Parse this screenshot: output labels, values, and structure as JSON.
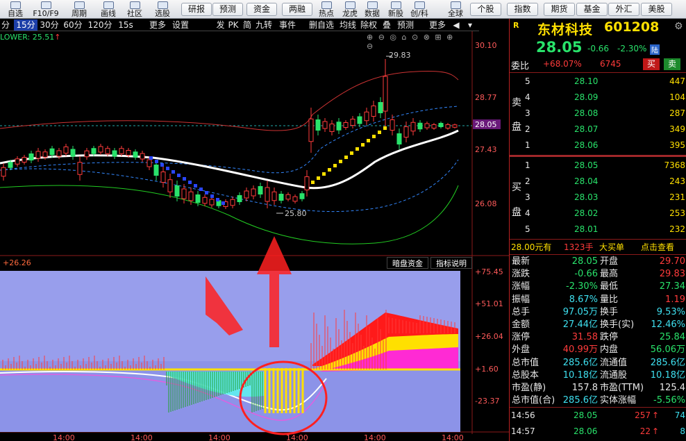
{
  "toolbar": {
    "left_items": [
      "自选",
      "F10/F9",
      "周期",
      "画线",
      "社区",
      "选股"
    ],
    "buttons_mid": [
      "研报",
      "预测",
      "资金",
      "两融"
    ],
    "right_items": [
      "热点",
      "龙虎",
      "数据",
      "新股",
      "创/科",
      "全球"
    ],
    "buttons_right": [
      "个股",
      "指数",
      "期货",
      "基金",
      "外汇",
      "美股"
    ]
  },
  "subbar": {
    "items": [
      "分",
      "15分",
      "30分",
      "60分",
      "120分",
      "15s",
      "更多",
      "设置",
      "发",
      "PK",
      "简",
      "九转",
      "事件",
      "删自选",
      "均线",
      "除权",
      "叠",
      "预测",
      "更多"
    ],
    "active": "15分"
  },
  "main_chart": {
    "indicator_label": "LOWER: 25.51",
    "indicator_arrow": "↑",
    "price_ticks": [
      "30.10",
      "28.77",
      "28.05",
      "27.43",
      "26.08"
    ],
    "high_label": "29.83",
    "low_label": "25.80"
  },
  "lower_chart": {
    "value_label": "+26.26",
    "btn1": "暗盘资金",
    "btn2": "指标说明",
    "ticks": [
      "+75.45",
      "+51.01",
      "+26.04",
      "+1.60",
      "-23.37"
    ]
  },
  "time_axis": [
    "14:00",
    "14:00",
    "14:00",
    "14:00",
    "14:00",
    "14:00"
  ],
  "quote": {
    "r_label": "R",
    "name": "东材科技",
    "code": "601208",
    "price": "28.05",
    "change": "-0.66",
    "pct": "-2.30%",
    "tag": "陆",
    "weibi_label": "委比",
    "weibi": "+68.07%",
    "weicha": "6745",
    "sell_btn": "买",
    "buy_btn": "卖"
  },
  "sell_side": {
    "label1": "卖",
    "label2": "盘",
    "levels": [
      {
        "n": "5",
        "p": "28.10",
        "v": "447"
      },
      {
        "n": "4",
        "p": "28.09",
        "v": "104"
      },
      {
        "n": "3",
        "p": "28.08",
        "v": "287"
      },
      {
        "n": "2",
        "p": "28.07",
        "v": "349"
      },
      {
        "n": "1",
        "p": "28.06",
        "v": "395"
      }
    ]
  },
  "buy_side": {
    "label1": "买",
    "label2": "盘",
    "levels": [
      {
        "n": "1",
        "p": "28.05",
        "v": "7368"
      },
      {
        "n": "2",
        "p": "28.04",
        "v": "243"
      },
      {
        "n": "3",
        "p": "28.03",
        "v": "231"
      },
      {
        "n": "4",
        "p": "28.02",
        "v": "253"
      },
      {
        "n": "5",
        "p": "28.01",
        "v": "232"
      }
    ]
  },
  "bigorder": {
    "price": "28.00元有",
    "vol": "1323手",
    "type": "大买单",
    "link": "点击查看"
  },
  "stats": [
    {
      "l1": "最新",
      "v1": "28.05",
      "c1": "grn",
      "l2": "开盘",
      "v2": "29.70",
      "c2": "red"
    },
    {
      "l1": "涨跌",
      "v1": "-0.66",
      "c1": "grn",
      "l2": "最高",
      "v2": "29.83",
      "c2": "red"
    },
    {
      "l1": "涨幅",
      "v1": "-2.30%",
      "c1": "grn",
      "l2": "最低",
      "v2": "27.34",
      "c2": "grn"
    },
    {
      "l1": "振幅",
      "v1": "8.67%",
      "c1": "cy",
      "l2": "量比",
      "v2": "1.19",
      "c2": "red"
    },
    {
      "l1": "总手",
      "v1": "97.05万",
      "c1": "cy",
      "l2": "换手",
      "v2": "9.53%",
      "c2": "cy"
    },
    {
      "l1": "金额",
      "v1": "27.44亿",
      "c1": "cy",
      "l2": "换手(实)",
      "v2": "12.46%",
      "c2": "cy"
    },
    {
      "l1": "涨停",
      "v1": "31.58",
      "c1": "red",
      "l2": "跌停",
      "v2": "25.84",
      "c2": "grn"
    },
    {
      "l1": "外盘",
      "v1": "40.99万",
      "c1": "red",
      "l2": "内盘",
      "v2": "56.06万",
      "c2": "grn"
    },
    {
      "l1": "总市值",
      "v1": "285.6亿",
      "c1": "cy",
      "l2": "流通值",
      "v2": "285.6亿",
      "c2": "cy"
    },
    {
      "l1": "总股本",
      "v1": "10.18亿",
      "c1": "cy",
      "l2": "流通股",
      "v2": "10.18亿",
      "c2": "cy"
    },
    {
      "l1": "市盈(静)",
      "v1": "157.8",
      "c1": "wh",
      "l2": "市盈(TTM)",
      "v2": "125.4",
      "c2": "wh"
    },
    {
      "l1": "总市值(合)",
      "v1": "285.6亿",
      "c1": "cy",
      "l2": "实体涨幅",
      "v2": "-5.56%",
      "c2": "grn"
    }
  ],
  "ticks": [
    {
      "t": "14:56",
      "p": "28.05",
      "v": "257",
      "d": "↑",
      "x": "74"
    },
    {
      "t": "14:57",
      "p": "28.06",
      "v": "22",
      "d": "↑",
      "x": "8"
    }
  ],
  "colors": {
    "up": "#ff3b3b",
    "down": "#29e36b",
    "bg": "#000000",
    "accent": "#1d3fa8"
  }
}
